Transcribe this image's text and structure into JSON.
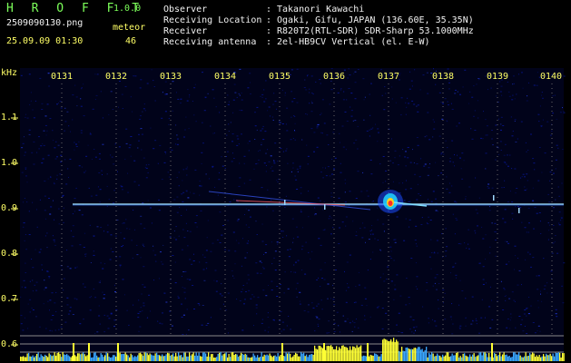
{
  "header": {
    "app_title": "H R O F F T",
    "version": "1.0.0",
    "filename": "2509090130.png",
    "meteor_label": "meteor",
    "meteor_count": "46",
    "datetime": "25.09.09 01:30"
  },
  "station_info": [
    {
      "label": "Observer",
      "sep": ":",
      "value": "Takanori Kawachi"
    },
    {
      "label": "Receiving Location",
      "sep": ":",
      "value": "Ogaki, Gifu, JAPAN (136.60E, 35.35N)"
    },
    {
      "label": "Receiver",
      "sep": ":",
      "value": "R820T2(RTL-SDR) SDR-Sharp 53.1000MHz"
    },
    {
      "label": "Receiving antenna",
      "sep": ":",
      "value": "2el-HB9CV Vertical (el. E-W)"
    }
  ],
  "spectrogram": {
    "y_unit": "kHz",
    "x_ticks": [
      "0131",
      "0132",
      "0133",
      "0134",
      "0135",
      "0136",
      "0137",
      "0138",
      "0139",
      "0140"
    ],
    "y_ticks": [
      "1.1",
      "1.0",
      "0.9",
      "0.8",
      "0.7",
      "0.6"
    ],
    "x_range_minutes": [
      0,
      9
    ],
    "y_range_khz": [
      0.6,
      1.15
    ],
    "carrier_khz": 0.91,
    "colors": {
      "background": "#000000",
      "noise": "#0a1aa8",
      "carrier": "#a8e6ff",
      "echo_hot": "#ff2a2a",
      "echo_warm": "#ffd21a",
      "meteor_bar": "#ffff33",
      "baseline_bar": "#3aa8ff"
    }
  }
}
